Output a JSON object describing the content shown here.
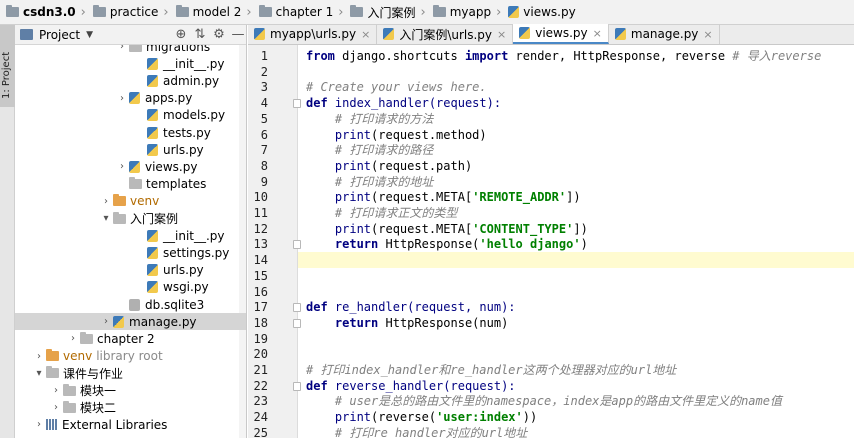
{
  "breadcrumbs": [
    {
      "label": "csdn3.0",
      "icon": "folder-icon"
    },
    {
      "label": "practice",
      "icon": "folder-icon"
    },
    {
      "label": "model 2",
      "icon": "folder-icon"
    },
    {
      "label": "chapter 1",
      "icon": "folder-icon"
    },
    {
      "label": "入门案例",
      "icon": "folder-icon"
    },
    {
      "label": "myapp",
      "icon": "folder-icon"
    },
    {
      "label": "views.py",
      "icon": "python-file-icon"
    }
  ],
  "tool_stripe": {
    "project_tab": "1: Project"
  },
  "project_panel": {
    "title": "Project",
    "tree": [
      {
        "label": "migrations",
        "type": "folder",
        "expanded": false
      },
      {
        "label": "__init__.py",
        "type": "py"
      },
      {
        "label": "admin.py",
        "type": "py"
      },
      {
        "label": "apps.py",
        "type": "py",
        "expandable": true
      },
      {
        "label": "models.py",
        "type": "py"
      },
      {
        "label": "tests.py",
        "type": "py"
      },
      {
        "label": "urls.py",
        "type": "py"
      },
      {
        "label": "views.py",
        "type": "py",
        "expandable": true
      },
      {
        "label": "templates",
        "type": "folder"
      },
      {
        "label": "venv",
        "type": "folder-orange",
        "expandable": true
      },
      {
        "label": "入门案例",
        "type": "folder",
        "expanded": true
      },
      {
        "label": "__init__.py",
        "type": "py"
      },
      {
        "label": "settings.py",
        "type": "py"
      },
      {
        "label": "urls.py",
        "type": "py"
      },
      {
        "label": "wsgi.py",
        "type": "py"
      },
      {
        "label": "db.sqlite3",
        "type": "db"
      },
      {
        "label": "manage.py",
        "type": "py",
        "expandable": true,
        "selected": true
      },
      {
        "label": "chapter 2",
        "type": "folder",
        "expandable": true
      },
      {
        "label": "venv",
        "suffix": "library root",
        "type": "folder-orange",
        "expandable": true
      },
      {
        "label": "课件与作业",
        "type": "folder",
        "expanded": true
      },
      {
        "label": "模块一",
        "type": "folder",
        "expandable": true
      },
      {
        "label": "模块二",
        "type": "folder",
        "expandable": true
      },
      {
        "label": "External Libraries",
        "type": "lib",
        "expandable": true
      }
    ]
  },
  "editor_tabs": [
    {
      "label": "myapp\\urls.py",
      "active": false
    },
    {
      "label": "入门案例\\urls.py",
      "active": false
    },
    {
      "label": "views.py",
      "active": true
    },
    {
      "label": "manage.py",
      "active": false
    }
  ],
  "code": {
    "current_line": 14,
    "lines": [
      {
        "n": "1",
        "tokens": [
          [
            "from",
            "kw"
          ],
          [
            " django.shortcuts ",
            "plain"
          ],
          [
            "import",
            "kw"
          ],
          [
            " render, HttpResponse, reverse ",
            "plain"
          ],
          [
            "# 导入reverse",
            "com"
          ]
        ]
      },
      {
        "n": "2",
        "tokens": []
      },
      {
        "n": "3",
        "tokens": [
          [
            "# Create your views here.",
            "com"
          ]
        ]
      },
      {
        "n": "4",
        "tokens": [
          [
            "def",
            "kw"
          ],
          [
            " index_handler(request):",
            "fn"
          ]
        ]
      },
      {
        "n": "5",
        "tokens": [
          [
            "    # 打印请求的方法",
            "com"
          ]
        ]
      },
      {
        "n": "6",
        "tokens": [
          [
            "    ",
            "plain"
          ],
          [
            "print",
            "bi"
          ],
          [
            "(request.method)",
            "plain"
          ]
        ]
      },
      {
        "n": "7",
        "tokens": [
          [
            "    # 打印请求的路径",
            "com"
          ]
        ]
      },
      {
        "n": "8",
        "tokens": [
          [
            "    ",
            "plain"
          ],
          [
            "print",
            "bi"
          ],
          [
            "(request.path)",
            "plain"
          ]
        ]
      },
      {
        "n": "9",
        "tokens": [
          [
            "    # 打印请求的地址",
            "com"
          ]
        ]
      },
      {
        "n": "10",
        "tokens": [
          [
            "    ",
            "plain"
          ],
          [
            "print",
            "bi"
          ],
          [
            "(request.META[",
            "plain"
          ],
          [
            "'REMOTE_ADDR'",
            "str"
          ],
          [
            "])",
            "plain"
          ]
        ]
      },
      {
        "n": "11",
        "tokens": [
          [
            "    # 打印请求正文的类型",
            "com"
          ]
        ]
      },
      {
        "n": "12",
        "tokens": [
          [
            "    ",
            "plain"
          ],
          [
            "print",
            "bi"
          ],
          [
            "(request.META[",
            "plain"
          ],
          [
            "'CONTENT_TYPE'",
            "str"
          ],
          [
            "])",
            "plain"
          ]
        ]
      },
      {
        "n": "13",
        "tokens": [
          [
            "    ",
            "plain"
          ],
          [
            "return",
            "kw"
          ],
          [
            " HttpResponse(",
            "plain"
          ],
          [
            "'hello django'",
            "str"
          ],
          [
            ")",
            "plain"
          ]
        ]
      },
      {
        "n": "14",
        "tokens": []
      },
      {
        "n": "15",
        "tokens": []
      },
      {
        "n": "16",
        "tokens": []
      },
      {
        "n": "17",
        "tokens": [
          [
            "def",
            "kw"
          ],
          [
            " re_handler(request, num):",
            "fn"
          ]
        ]
      },
      {
        "n": "18",
        "tokens": [
          [
            "    ",
            "plain"
          ],
          [
            "return",
            "kw"
          ],
          [
            " HttpResponse(num)",
            "plain"
          ]
        ]
      },
      {
        "n": "19",
        "tokens": []
      },
      {
        "n": "20",
        "tokens": []
      },
      {
        "n": "21",
        "tokens": [
          [
            "# 打印index_handler和re_handler这两个处理器对应的url地址",
            "com"
          ]
        ]
      },
      {
        "n": "22",
        "tokens": [
          [
            "def",
            "kw"
          ],
          [
            " reverse_handler(request):",
            "fn"
          ]
        ]
      },
      {
        "n": "23",
        "tokens": [
          [
            "    # user是总的路由文件里的namespace，index是app的路由文件里定义的name值",
            "com"
          ]
        ]
      },
      {
        "n": "24",
        "tokens": [
          [
            "    ",
            "plain"
          ],
          [
            "print",
            "bi"
          ],
          [
            "(reverse(",
            "plain"
          ],
          [
            "'user:index'",
            "str"
          ],
          [
            "))",
            "plain"
          ]
        ]
      },
      {
        "n": "25",
        "tokens": [
          [
            "    # 打印re_handler对应的url地址",
            "com"
          ]
        ]
      }
    ]
  },
  "colors": {
    "keyword": "#000080",
    "string": "#008000",
    "comment": "#808080",
    "current_line": "#fffbd0",
    "accent": "#4a88c7"
  }
}
